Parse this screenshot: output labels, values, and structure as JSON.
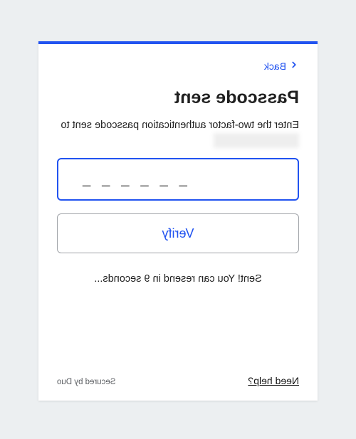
{
  "back_label": "Back",
  "title": "Passcode sent",
  "desc_prefix": "Enter the two-factor authentication passcode sent to ",
  "desc_redacted": "XXXXXXXXXXXX",
  "passcode_placeholder": "______",
  "verify_label": "Verify",
  "status_text": "Sent! You can resend in 9 seconds...",
  "need_help_label": "Need help?",
  "secured_label": "Secured by Duo",
  "colors": {
    "accent": "#2153f0"
  }
}
